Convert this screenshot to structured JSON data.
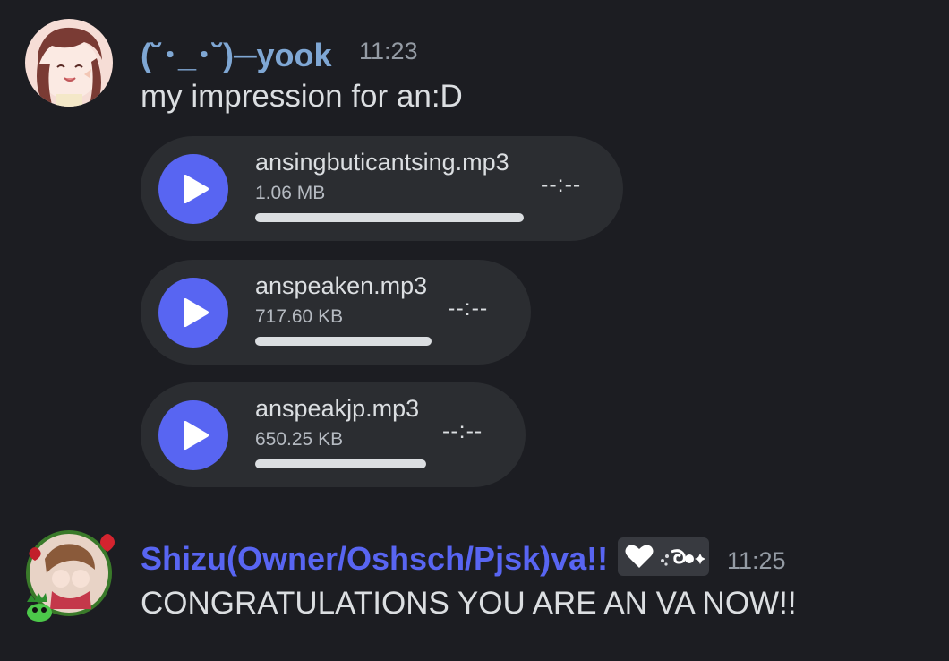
{
  "messages": [
    {
      "author": "(˘･_･˘)─yook",
      "time": "11:23",
      "text": "my impression for an:D",
      "author_color": "#7fa7d4",
      "attachments": [
        {
          "name": "ansingbuticantsing.mp3",
          "size": "1.06 MB",
          "time": "--:--",
          "progress": 0
        },
        {
          "name": "anspeaken.mp3",
          "size": "717.60 KB",
          "time": "--:--",
          "progress": 0
        },
        {
          "name": "anspeakjp.mp3",
          "size": "650.25 KB",
          "time": "--:--",
          "progress": 0
        }
      ]
    },
    {
      "author": "Shizu(Owner/Oshsch/Pjsk)va!!",
      "time": "11:25",
      "text": "CONGRATULATIONS YOU ARE AN VA NOW!!",
      "author_color": "#5865f2",
      "tag_icons": [
        "heart-icon",
        "cloud-swirl-icon"
      ]
    }
  ],
  "colors": {
    "background": "#1c1d22",
    "audio_background": "#2b2d31",
    "play_button": "#5865f2"
  }
}
